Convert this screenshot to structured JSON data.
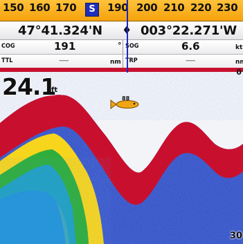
{
  "compass": {
    "ticks": [
      "150",
      "160",
      "170",
      "190",
      "200",
      "210",
      "220",
      "230"
    ],
    "heading_marker": "S"
  },
  "position": {
    "latitude": "47°41.324'N",
    "separator": "♦",
    "longitude": "003°22.271'W"
  },
  "row1": {
    "cog_label": "COG",
    "cog_value": "191",
    "cog_unit": "°",
    "sog_label": "SOG",
    "sog_value": "6.6",
    "sog_unit": "kt"
  },
  "row2": {
    "ttl_label": "TTL",
    "ttl_value": "------",
    "ttl_unit": "nm",
    "trp_label": "TRP",
    "trp_value": "------",
    "trp_unit": "nm"
  },
  "sonar": {
    "depth": "24.1",
    "depth_unit": "ft",
    "scale_top": "0",
    "scale_bottom": "30",
    "fish_depth": "88"
  },
  "colors": {
    "bottom_red": "#c8102e",
    "compass_orange": "#f5a20c",
    "heading_blue": "#1f2fb8"
  }
}
